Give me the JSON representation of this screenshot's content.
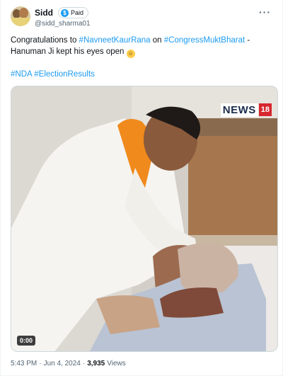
{
  "author": {
    "name": "Sidd",
    "badge": "Paid",
    "badge_icon": "dollar-badge-icon",
    "handle": "@sidd_sharma01"
  },
  "menu_icon": "more-options-icon",
  "tweet": {
    "part1": "Congratulations to ",
    "tag1": "#NavneetKaurRana",
    "part2": " on ",
    "tag2": "#CongressMuktBharat",
    "part3": " - Hanuman Ji kept his eyes open ",
    "emoji": "grinning-face-emoji",
    "hashtags": [
      "#NDA",
      "#ElectionResults"
    ]
  },
  "media": {
    "logo_text": "NEWS",
    "logo_num": "18",
    "duration": "0:00"
  },
  "footer": {
    "time": "5:43 PM",
    "sep1": "·",
    "date": "Jun 4, 2024",
    "sep2": "·",
    "views": "3,935",
    "views_label": "Views"
  },
  "colors": {
    "link": "#1d9bf0",
    "text": "#0f1419",
    "muted": "#536471",
    "logo_red": "#d7262e"
  }
}
